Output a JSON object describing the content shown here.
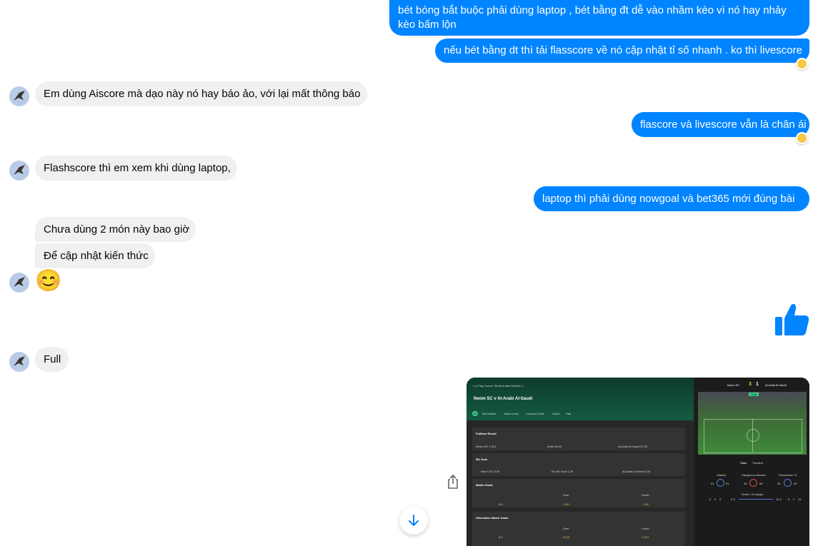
{
  "messages": {
    "m1_line1": "bét bóng bắt buộc phải dùng laptop , bét bằng đt dễ vào nhầm kèo vì nó hay nhảy",
    "m1_line2": "kèo bấm lộn",
    "m2": "nếu bét bằng dt thì tải flasscore về nó cập nhật tỉ số nhanh . ko thì livescore",
    "m3": "Em dùng Aiscore mà dạo này nó hay báo ảo, với lại mất thông báo",
    "m4": "flascore và livescore vẫn là chân ái",
    "m5": "Flashscore thì em xem khi dùng laptop,",
    "m6": "laptop thì phải dùng nowgoal và bet365 mới đúng bài",
    "m7": "Chưa dùng 2 món này bao giờ",
    "m8": "Để cập nhật kiến thức",
    "m9": "Full"
  },
  "emoji": {
    "smile": "😊"
  },
  "colors": {
    "outgoing": "#0084ff",
    "incoming": "#f0f0f0",
    "reaction": "#f7c947"
  },
  "icons": [
    "avatar-bird",
    "thumbs-up-icon",
    "share-icon",
    "arrow-down-icon",
    "reaction-emoji-icon"
  ],
  "attachment": {
    "breadcrumb": "< In-Play Soccer  Saudi Arabia Division 1",
    "match_title": "Neom SC v Al-Arabi Al-Saudi",
    "tabs": [
      "All",
      "Bet Builder",
      "Asian Lines",
      "Corners/Cards",
      "Goals",
      "Half"
    ],
    "sections": [
      {
        "title": "Fulltime Result",
        "row": [
          "Neom SC 1.001",
          "Draw 34.00",
          "Al-Arabi Al-Saudi 67.00"
        ]
      },
      {
        "title": "5th Goal",
        "row": [
          "Neom SC 6.00",
          "No 5th Goal 1.20",
          "Al-Arabi Al-Saudi 6.00"
        ]
      },
      {
        "title": "Match Goals",
        "cols": [
          "Over",
          "Under"
        ],
        "row": [
          "4.5",
          "3.60",
          "1.26"
        ]
      },
      {
        "title": "Alternative Match Goals",
        "cols": [
          "Over",
          "Under"
        ],
        "row": [
          "5.5",
          "13.00",
          "1.013"
        ]
      }
    ],
    "scoreboard": {
      "home": "Neom SC",
      "home_score": "3",
      "away_score": "1",
      "away": "Al Arabi Al Saudi",
      "status": "Goal"
    },
    "stats_tabs": [
      "Stats",
      "Timeline"
    ],
    "stats": {
      "attacks_label": "Attacks",
      "attacks": [
        "91",
        "94"
      ],
      "dangerous_label": "Dangerous Attacks",
      "dangerous": [
        "28",
        "89"
      ],
      "possession_label": "Possession %",
      "possession": [
        "45",
        "55"
      ],
      "shots_label": "Shots / On target",
      "shots_home": "0-3",
      "shots_away": "10-2",
      "cards_home": [
        "2",
        "0",
        "2"
      ],
      "cards_away": [
        "5",
        "2",
        "14"
      ]
    }
  }
}
